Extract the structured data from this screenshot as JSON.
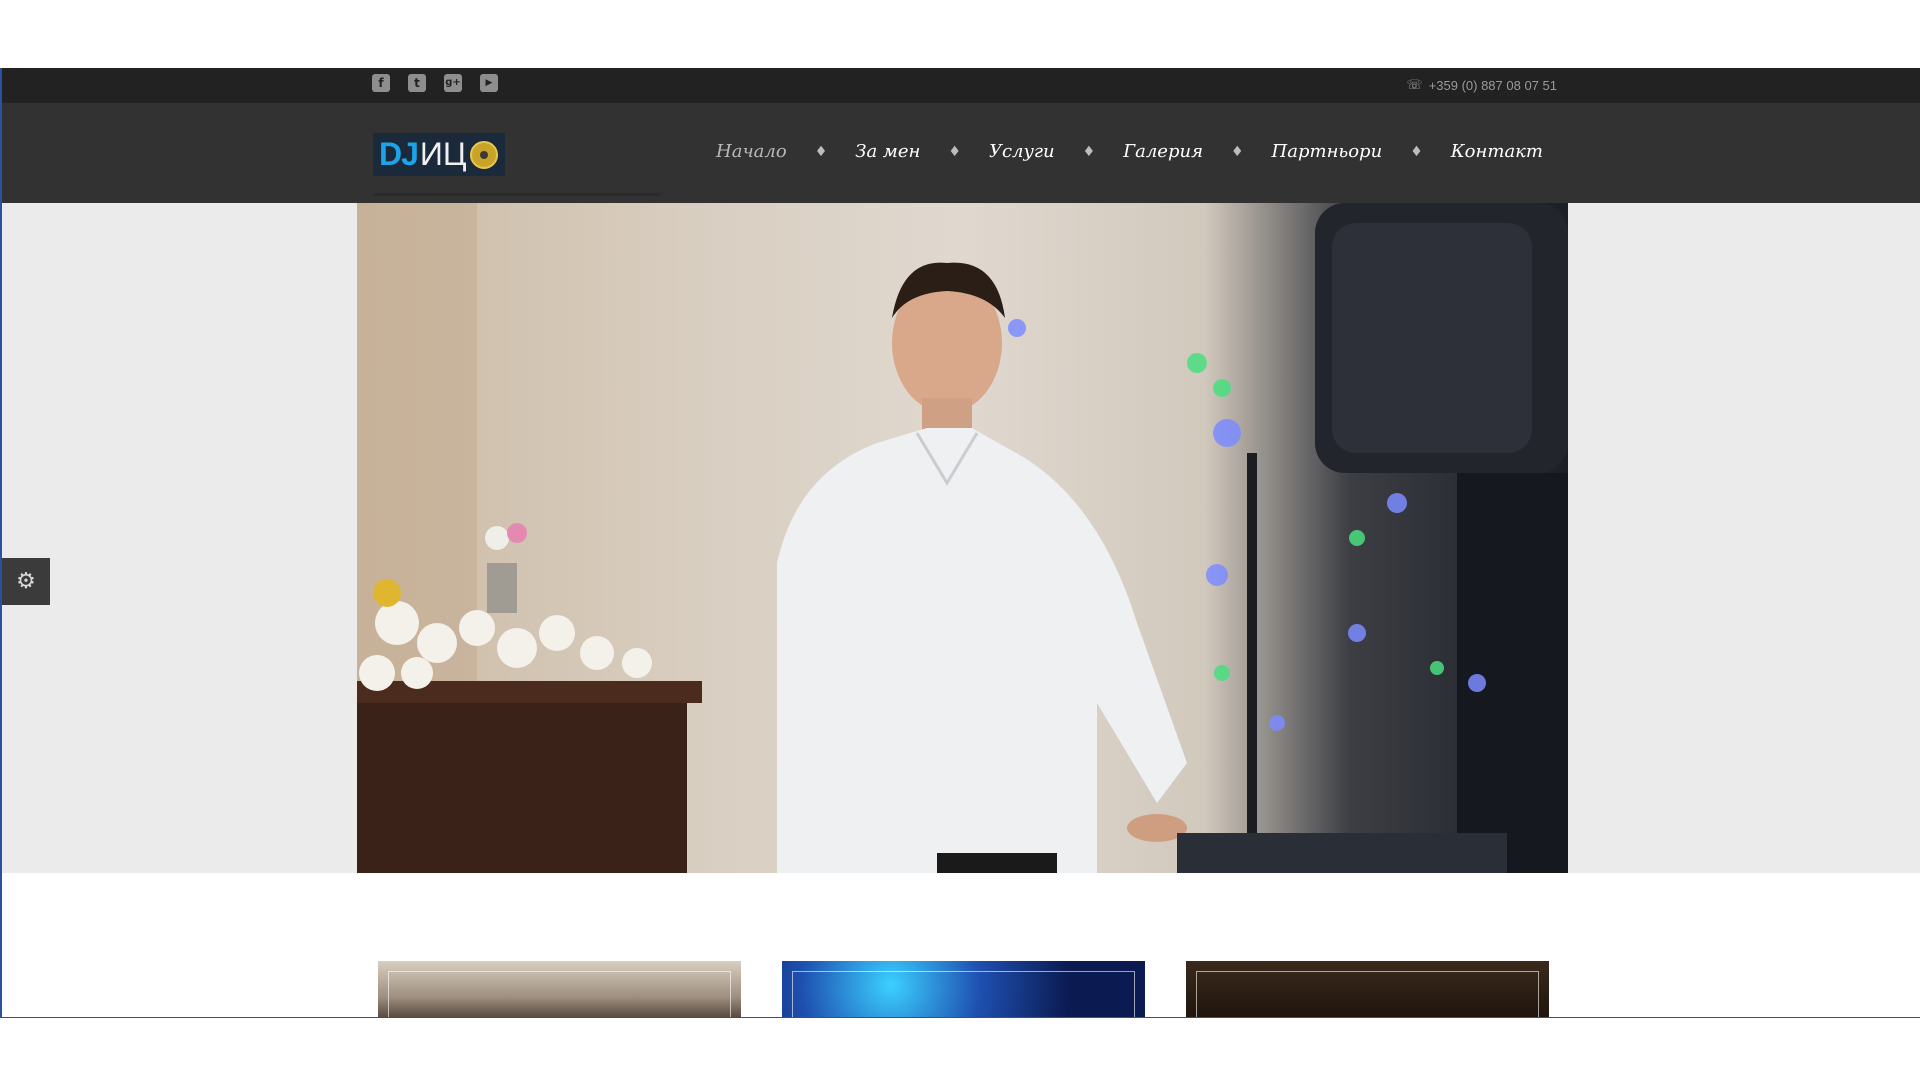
{
  "topbar": {
    "social": [
      {
        "name": "facebook-icon",
        "glyph": "f"
      },
      {
        "name": "twitter-icon",
        "glyph": "t"
      },
      {
        "name": "google-plus-icon",
        "glyph": "g+"
      },
      {
        "name": "youtube-icon",
        "glyph": "▶"
      }
    ],
    "phone_icon": "phone-icon",
    "phone": "+359 (0) 887 08 07 51"
  },
  "logo": {
    "dj": "DJ",
    "name": "ИЦ"
  },
  "nav": {
    "items": [
      {
        "label": "Начало",
        "active": true
      },
      {
        "label": "За мен",
        "active": false
      },
      {
        "label": "Услуги",
        "active": false
      },
      {
        "label": "Галерия",
        "active": false
      },
      {
        "label": "Партньори",
        "active": false
      },
      {
        "label": "Контакт",
        "active": false
      }
    ],
    "separator": "♦"
  },
  "settings": {
    "icon": "gear-icon",
    "glyph": "⚙"
  },
  "colors": {
    "topbar_bg": "#222222",
    "header_bg": "#323232",
    "hero_bg": "#ebebeb",
    "logo_accent": "#1fa3e8"
  }
}
